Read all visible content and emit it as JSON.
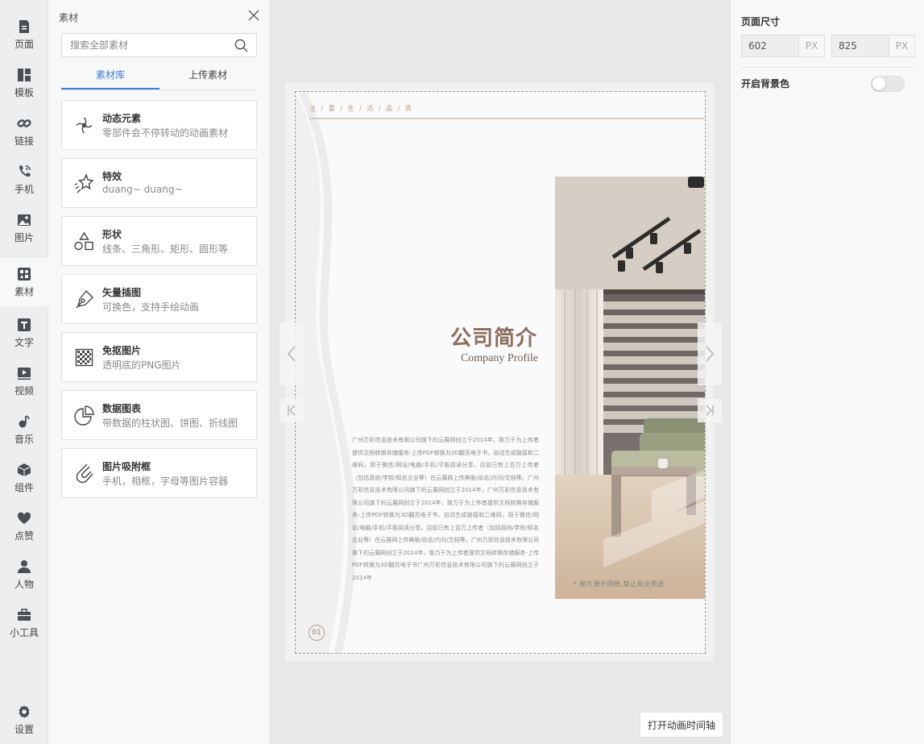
{
  "nav": {
    "items": [
      {
        "label": "页面",
        "icon": "page-icon"
      },
      {
        "label": "模板",
        "icon": "template-icon"
      },
      {
        "label": "链接",
        "icon": "link-icon"
      },
      {
        "label": "手机",
        "icon": "phone-icon"
      },
      {
        "label": "图片",
        "icon": "image-icon"
      },
      {
        "label": "素材",
        "icon": "asset-icon",
        "active": true
      },
      {
        "label": "文字",
        "icon": "text-icon"
      },
      {
        "label": "视频",
        "icon": "video-icon"
      },
      {
        "label": "音乐",
        "icon": "music-icon"
      },
      {
        "label": "组件",
        "icon": "component-icon"
      },
      {
        "label": "点赞",
        "icon": "heart-icon"
      },
      {
        "label": "人物",
        "icon": "person-icon"
      },
      {
        "label": "小工具",
        "icon": "toolbox-icon"
      }
    ],
    "settings": {
      "label": "设置",
      "icon": "gear-icon"
    }
  },
  "asset_panel": {
    "title": "素材",
    "search_placeholder": "搜索全部素材",
    "tabs": [
      "素材库",
      "上传素材"
    ],
    "cards": [
      {
        "title": "动态元素",
        "subtitle": "零部件会不停转动的动画素材",
        "icon": "spin-icon"
      },
      {
        "title": "特效",
        "subtitle": "duang~ duang~",
        "icon": "sparkle-icon"
      },
      {
        "title": "形状",
        "subtitle": "线条、三角形、矩形、圆形等",
        "icon": "shapes-icon"
      },
      {
        "title": "矢量插图",
        "subtitle": "可换色，支持手绘动画",
        "icon": "pen-icon"
      },
      {
        "title": "免抠图片",
        "subtitle": "透明底的PNG图片",
        "icon": "transparent-icon"
      },
      {
        "title": "数据图表",
        "subtitle": "带数据的柱状图、饼图、折线图",
        "icon": "pie-chart-icon"
      },
      {
        "title": "图片吸附框",
        "subtitle": "手机，相框，字母等图片容器",
        "icon": "magnet-icon"
      }
    ]
  },
  "page": {
    "tagline": "注 / 重 / 生 / 活 / 品 / 质",
    "title_cn": "公司简介",
    "title_en": "Company Profile",
    "body": "广州万彩信息技术有限公司旗下的云展网创立于2014年，致力于为上传者提供文档转换存储服务-上传PDF转换为3D翻页电子书，自动生成链接和二维码，用于微信/网站/电脑/手机/平板阅读分享。目前已有上百万上传者（包括政府/学校/知名企业等）在云展网上传典册/杂志/内刊/文档等。广州万彩信息技术有限公司旗下的云展网创立于2014年，广州万彩信息技术有限公司旗下的云展网创立于2014年，致力于为上传者提供文档转换存储服务-上传PDF转换为3D翻页电子书，自动生成链接和二维码，用于微信/网站/电脑/手机/平板阅读分享。目前已有上百万上传者（包括政府/学校/知名企业等）在云展网上传典册/杂志/内刊/文档等。广州万彩信息技术有限公司旗下的云展网创立于2014年，致力于为上传者提供文档转换存储服务-上传PDF转换为3D翻页电子书广州万彩信息技术有限公司旗下的云展网创立于2014年",
    "caption": "* 图片源于网络,禁止商业用途",
    "page_number": "01"
  },
  "canvas": {
    "timeline_button": "打开动画时间轴"
  },
  "properties": {
    "size_label": "页面尺寸",
    "width": "602",
    "height": "825",
    "unit": "PX",
    "bg_label": "开启背景色",
    "bg_enabled": false
  }
}
